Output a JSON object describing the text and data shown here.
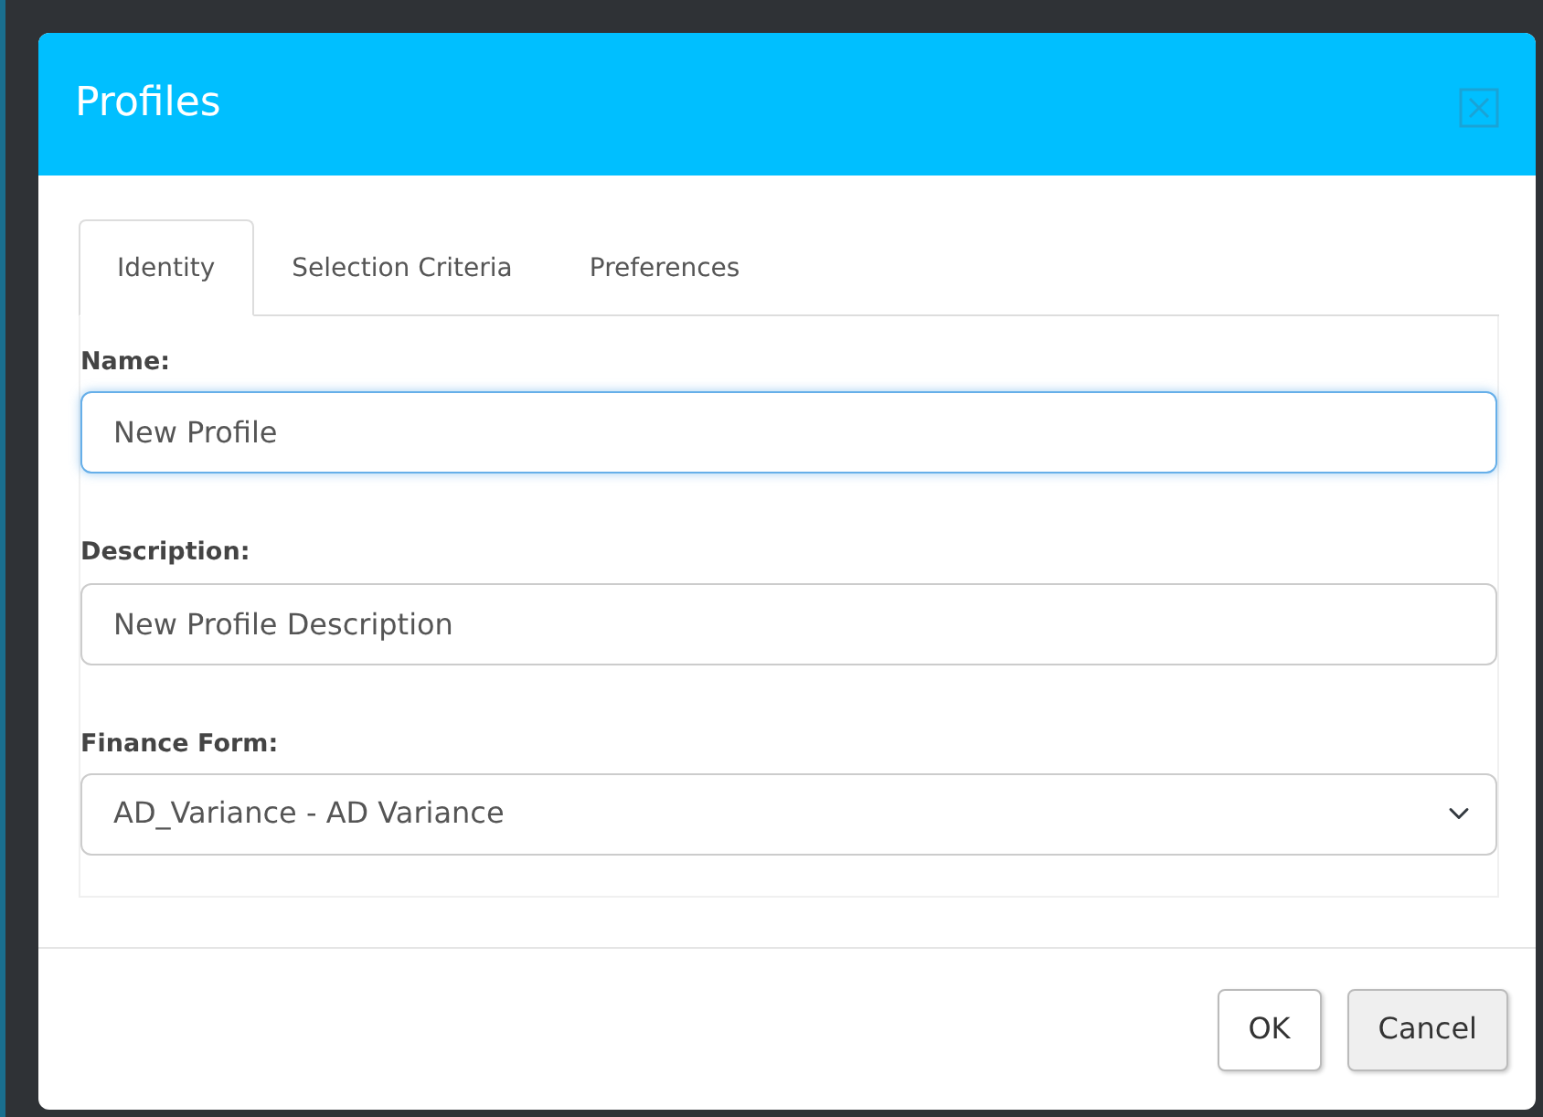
{
  "dialog": {
    "title": "Profiles"
  },
  "tabs": [
    {
      "label": "Identity",
      "selected": true
    },
    {
      "label": "Selection Criteria",
      "selected": false
    },
    {
      "label": "Preferences",
      "selected": false
    }
  ],
  "fields": [
    {
      "kind": "text",
      "label": "Name:",
      "value": "New Profile",
      "focused": true
    },
    {
      "kind": "text",
      "label": "Description:",
      "value": "New Profile Description",
      "focused": false
    },
    {
      "kind": "select",
      "label": "Finance Form:",
      "value": "AD_Variance - AD Variance",
      "focused": false
    }
  ],
  "buttons": [
    {
      "label": "OK",
      "kind": "default"
    },
    {
      "label": "Cancel",
      "kind": "secondary"
    }
  ]
}
